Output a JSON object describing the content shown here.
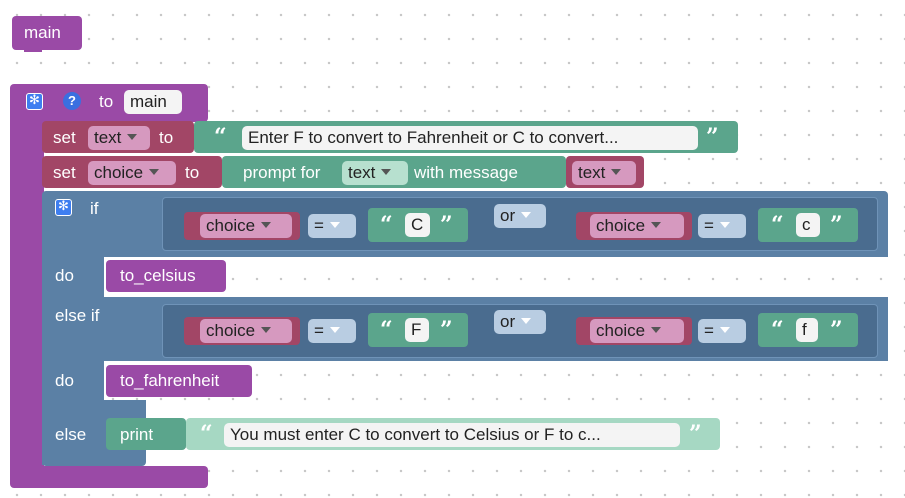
{
  "main_block": {
    "label": "main"
  },
  "procedure": {
    "to_label": "to",
    "name": "main",
    "help_glyph": "?"
  },
  "set1": {
    "set_label": "set",
    "variable": "text",
    "to_label": "to",
    "string": "Enter F to convert to Fahrenheit or C to convert..."
  },
  "set2": {
    "set_label": "set",
    "variable": "choice",
    "to_label": "to",
    "prompt_label": "prompt for",
    "prompt_type": "text",
    "with_message": "with message",
    "message_var": "text"
  },
  "if_block": {
    "if_label": "if",
    "cond1": {
      "left_var": "choice",
      "op": "=",
      "left_str": "C",
      "or_label": "or",
      "right_var": "choice",
      "right_op": "=",
      "right_str": "c"
    },
    "do1_label": "do",
    "call1": "to_celsius",
    "elseif_label": "else if",
    "cond2": {
      "left_var": "choice",
      "op": "=",
      "left_str": "F",
      "or_label": "or",
      "right_var": "choice",
      "right_op": "=",
      "right_str": "f"
    },
    "do2_label": "do",
    "call2": "to_fahrenheit",
    "else_label": "else",
    "print_label": "print",
    "print_string": "You must enter C to convert to Celsius or F to c..."
  },
  "quote_open": "“",
  "quote_close": "”",
  "colors": {
    "procedure": "#9a4aa6",
    "variables": "#a24666",
    "logic": "#5b80a5",
    "text": "#5ba58c"
  }
}
